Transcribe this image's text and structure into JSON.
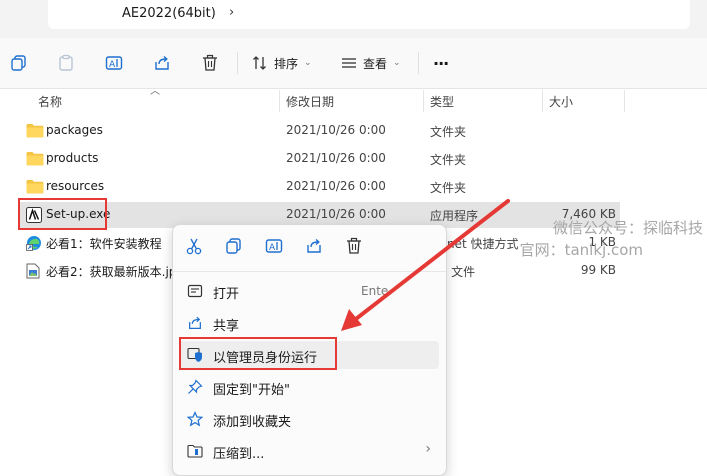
{
  "address": {
    "crumbs": [
      "AE2022(64bit)"
    ]
  },
  "toolbar": {
    "sort_label": "排序",
    "view_label": "查看",
    "more_label": "···"
  },
  "columns": {
    "name": "名称",
    "date": "修改日期",
    "type": "类型",
    "size": "大小"
  },
  "files": [
    {
      "name": "packages",
      "date": "2021/10/26 0:00",
      "type": "文件夹",
      "size": "",
      "icon": "folder-icon"
    },
    {
      "name": "products",
      "date": "2021/10/26 0:00",
      "type": "文件夹",
      "size": "",
      "icon": "folder-icon"
    },
    {
      "name": "resources",
      "date": "2021/10/26 0:00",
      "type": "文件夹",
      "size": "",
      "icon": "folder-icon"
    },
    {
      "name": "Set-up.exe",
      "date": "2021/10/26 0:00",
      "type": "应用程序",
      "size": "7,460 KB",
      "icon": "adobe-installer-icon",
      "selected": true
    },
    {
      "name": "必看1：软件安装教程",
      "date": "",
      "type": "net 快捷方式",
      "size": "1 KB",
      "icon": "edge-shortcut-icon"
    },
    {
      "name": "必看2：获取最新版本.jp",
      "date": "",
      "type": "G 文件",
      "size": "99 KB",
      "icon": "image-file-icon"
    }
  ],
  "watermark": {
    "line1": "微信公众号：探临科技",
    "line2": "官网：tanlkj.com"
  },
  "context_menu": {
    "items": [
      {
        "label": "打开",
        "shortcut": "Ente",
        "icon": "open-icon"
      },
      {
        "label": "共享",
        "icon": "share-icon"
      },
      {
        "label": "以管理员身份运行",
        "icon": "admin-shield-icon"
      },
      {
        "label": "固定到\"开始\"",
        "icon": "pin-icon"
      },
      {
        "label": "添加到收藏夹",
        "icon": "star-icon"
      },
      {
        "label": "压缩到...",
        "icon": "zip-icon",
        "submenu": "›"
      }
    ]
  },
  "colors": {
    "highlight": "#e53935",
    "folder": "#f4c542",
    "accent": "#0067c0"
  }
}
